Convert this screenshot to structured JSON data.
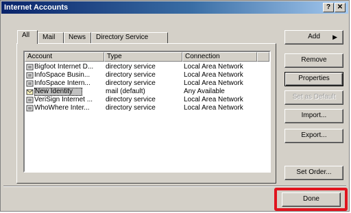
{
  "window": {
    "title": "Internet Accounts"
  },
  "title_buttons": {
    "help": "?",
    "close": "✕"
  },
  "tabs": [
    {
      "label": "All",
      "active": true
    },
    {
      "label": "Mail"
    },
    {
      "label": "News"
    },
    {
      "label": "Directory Service"
    }
  ],
  "list": {
    "columns": [
      "Account",
      "Type",
      "Connection"
    ],
    "rows": [
      {
        "account": "Bigfoot Internet D...",
        "type": "directory service",
        "connection": "Local Area Network",
        "icon": "directory-service-icon"
      },
      {
        "account": "InfoSpace Busin...",
        "type": "directory service",
        "connection": "Local Area Network",
        "icon": "directory-service-icon"
      },
      {
        "account": "InfoSpace Intern...",
        "type": "directory service",
        "connection": "Local Area Network",
        "icon": "directory-service-icon"
      },
      {
        "account": "New Identity",
        "type": "mail (default)",
        "connection": "Any Available",
        "icon": "mail-account-icon",
        "selected": true
      },
      {
        "account": "VeriSign Internet ...",
        "type": "directory service",
        "connection": "Local Area Network",
        "icon": "directory-service-icon"
      },
      {
        "account": "WhoWhere Inter...",
        "type": "directory service",
        "connection": "Local Area Network",
        "icon": "directory-service-icon"
      }
    ]
  },
  "buttons": {
    "add": "Add",
    "remove": "Remove",
    "properties": "Properties",
    "set_default": "Set as Default",
    "import": "Import...",
    "export": "Export...",
    "set_order": "Set Order...",
    "done": "Done"
  },
  "colors": {
    "highlight": "#e0141e",
    "title_bar": "#0a246a"
  }
}
